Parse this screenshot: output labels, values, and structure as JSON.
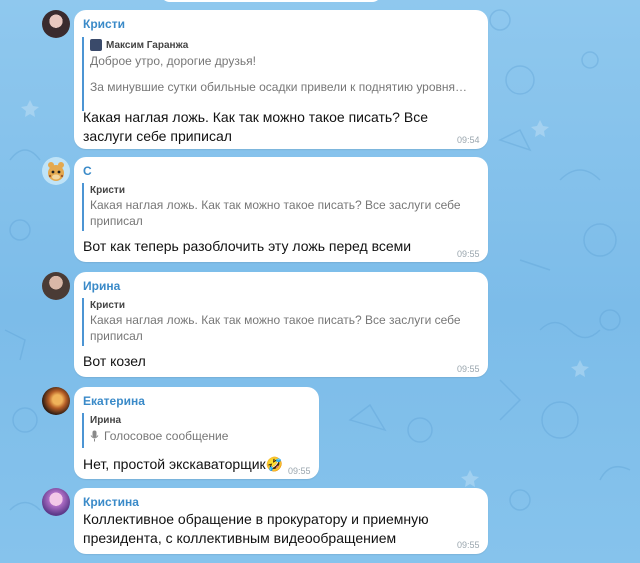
{
  "messages": [
    {
      "sender": "Кристи",
      "reply": {
        "author": "Максим Гаранжа",
        "lines": [
          "Доброе утро, дорогие друзья!",
          "За минувшие сутки обильные осадки привели к поднятию уровня…"
        ]
      },
      "text": "Какая наглая ложь. Как так можно такое писать? Все заслуги себе приписал",
      "time": "09:54"
    },
    {
      "sender": "С",
      "reply": {
        "author": "Кристи",
        "lines": [
          "Какая наглая ложь. Как так можно такое писать? Все заслуги себе приписал"
        ]
      },
      "text": "Вот как теперь разоблочить эту ложь перед всеми",
      "time": "09:55"
    },
    {
      "sender": "Ирина",
      "reply": {
        "author": "Кристи",
        "lines": [
          "Какая наглая ложь. Как так можно такое писать? Все заслуги себе приписал"
        ]
      },
      "text": "Вот козел",
      "time": "09:55"
    },
    {
      "sender": "Екатерина",
      "reply": {
        "author": "Ирина",
        "lines": [
          "Голосовое сообщение"
        ]
      },
      "text": "Нет, простой экскаваторщик🤣",
      "time": "09:55"
    },
    {
      "sender": "Кристина",
      "text": "Коллективное обращение в прокуратору и приемную президента, с коллективным видеообращением",
      "time": "09:55"
    }
  ],
  "colors": {
    "background": "#86c3ec",
    "bubble": "#ffffff",
    "sender_name": "#3a8ac8",
    "reply_bar": "#4c95d4"
  },
  "icons": {
    "reply_avatar_msg1": "user-avatar-icon",
    "reply_voice_msg4": "microphone-icon"
  }
}
